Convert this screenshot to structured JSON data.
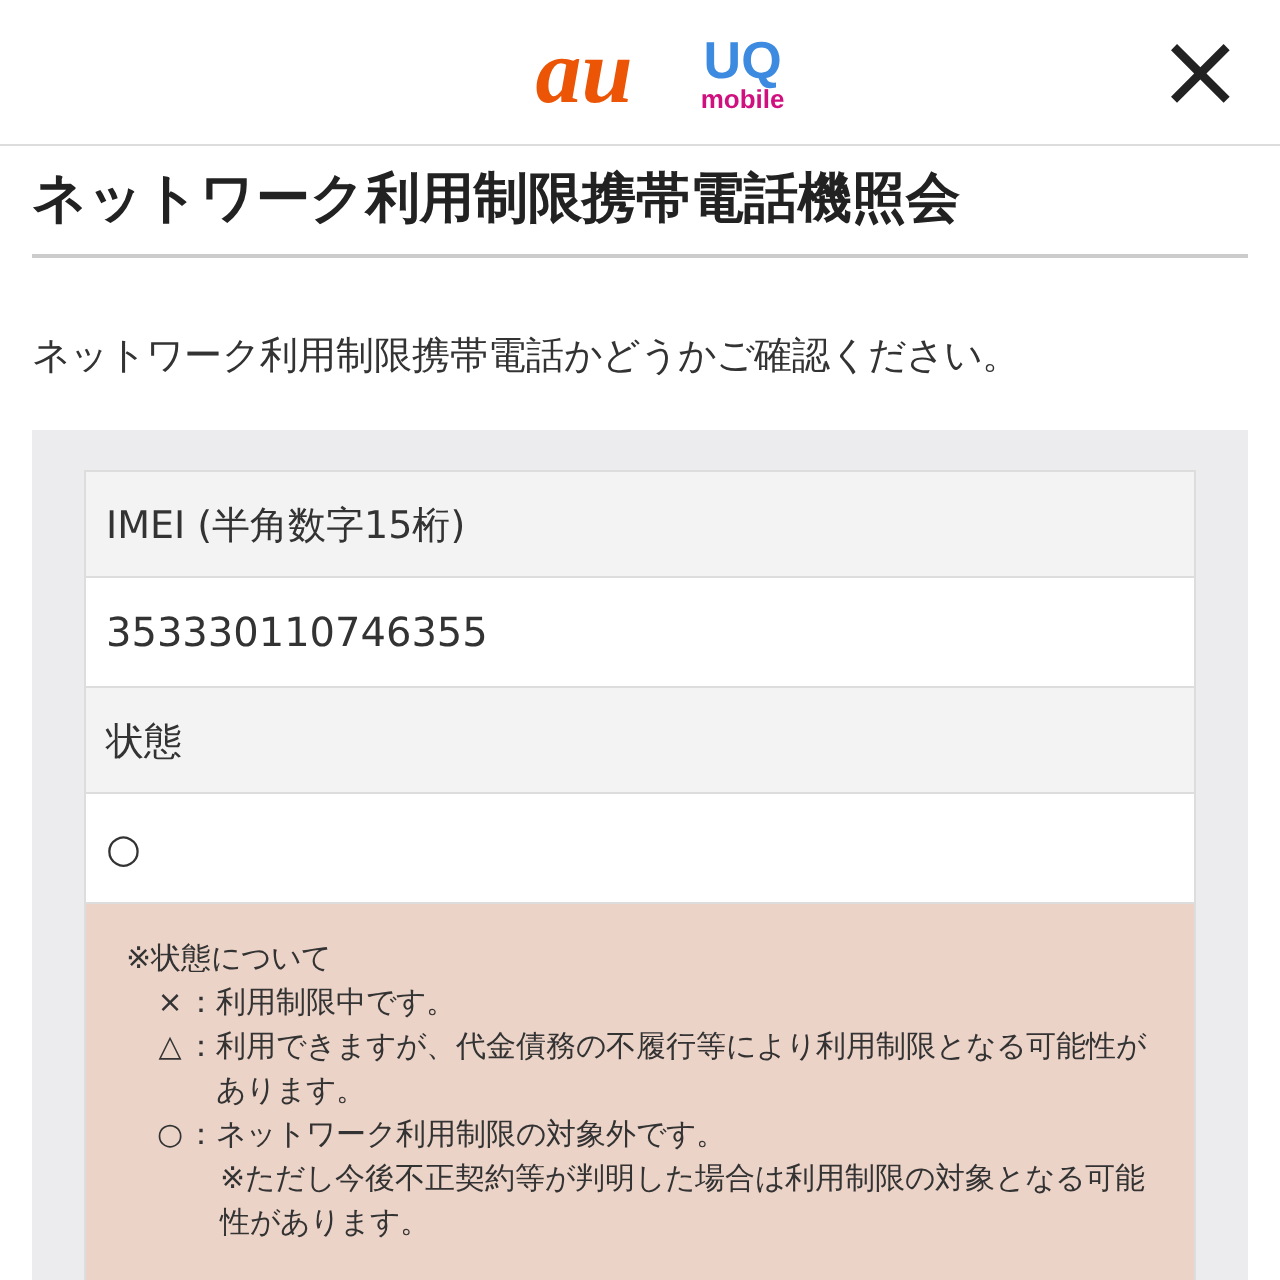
{
  "header": {
    "logos": [
      {
        "kind": "au",
        "text": "au"
      },
      {
        "kind": "uq",
        "text": "UQ",
        "subtext": "mobile"
      }
    ],
    "close": "×"
  },
  "title": "ネットワーク利用制限携帯電話機照会",
  "intro": "ネットワーク利用制限携帯電話かどうかご確認ください。",
  "fields": [
    {
      "label": "IMEI (半角数字15桁)",
      "value": "353330110746355"
    },
    {
      "label": "状態",
      "value": "○"
    }
  ],
  "notes": {
    "heading": "※状態について",
    "items": [
      {
        "mark": "×",
        "sep": "：",
        "text": "利用制限中です。"
      },
      {
        "mark": "△",
        "sep": "：",
        "text": "利用できますが、代金債務の不履行等により利用制限となる可能性があります。"
      },
      {
        "mark": "○",
        "sep": "：",
        "text": "ネットワーク利用制限の対象外です。",
        "sub": "※ただし今後不正契約等が判明した場合は利用制限の対象となる可能性があります。"
      }
    ]
  }
}
